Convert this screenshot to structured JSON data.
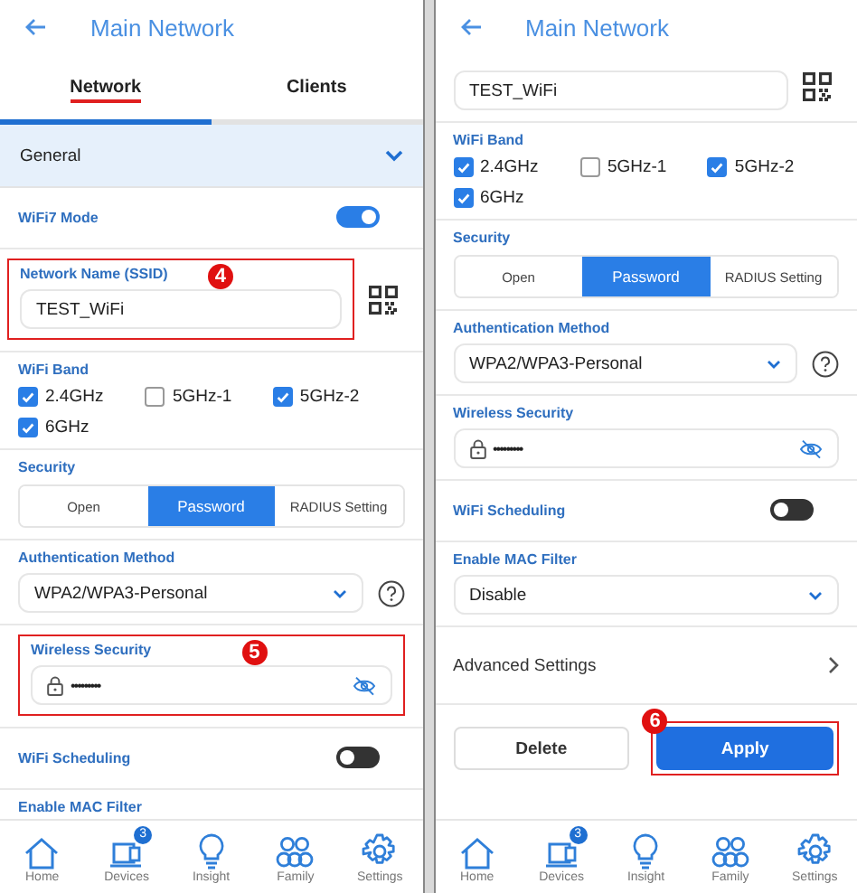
{
  "screens": [
    {
      "title": "Main Network",
      "tabs": [
        {
          "label": "Network",
          "selected": true,
          "annotated": true
        },
        {
          "label": "Clients",
          "selected": false,
          "annotated": false
        }
      ],
      "sections": [
        {
          "kind": "group",
          "label": "General",
          "expanded": true
        },
        {
          "kind": "toggle",
          "label": "WiFi7 Mode",
          "on": true
        },
        {
          "kind": "text_field",
          "label": "Network Name (SSID)",
          "value": "TEST_WiFi",
          "callout": "4"
        },
        {
          "kind": "checkboxes",
          "label": "WiFi Band",
          "options": [
            {
              "label": "2.4GHz",
              "checked": true
            },
            {
              "label": "5GHz-1",
              "checked": false
            },
            {
              "label": "5GHz-2",
              "checked": true
            },
            {
              "label": "6GHz",
              "checked": true
            }
          ]
        },
        {
          "kind": "segmented",
          "label": "Security",
          "options": [
            {
              "label": "Open",
              "selected": false
            },
            {
              "label": "Password",
              "selected": true
            },
            {
              "label": "RADIUS Setting",
              "selected": false
            }
          ]
        },
        {
          "kind": "select",
          "label": "Authentication Method",
          "value": "WPA2/WPA3-Personal",
          "help": true
        },
        {
          "kind": "password",
          "label": "Wireless Security",
          "value": "•••••••••",
          "callout": "5"
        },
        {
          "kind": "toggle",
          "label": "WiFi Scheduling",
          "on": false
        },
        {
          "kind": "heading",
          "label": "Enable MAC Filter"
        }
      ],
      "nav": [
        {
          "label": "Home"
        },
        {
          "label": "Devices",
          "badge": "3"
        },
        {
          "label": "Insight"
        },
        {
          "label": "Family"
        },
        {
          "label": "Settings"
        }
      ]
    },
    {
      "title": "Main Network",
      "sections": [
        {
          "kind": "text_field",
          "value": "TEST_WiFi"
        },
        {
          "kind": "checkboxes",
          "label": "WiFi Band",
          "options": [
            {
              "label": "2.4GHz",
              "checked": true
            },
            {
              "label": "5GHz-1",
              "checked": false
            },
            {
              "label": "5GHz-2",
              "checked": true
            },
            {
              "label": "6GHz",
              "checked": true
            }
          ]
        },
        {
          "kind": "segmented",
          "label": "Security",
          "options": [
            {
              "label": "Open",
              "selected": false
            },
            {
              "label": "Password",
              "selected": true
            },
            {
              "label": "RADIUS Setting",
              "selected": false
            }
          ]
        },
        {
          "kind": "select",
          "label": "Authentication Method",
          "value": "WPA2/WPA3-Personal",
          "help": true
        },
        {
          "kind": "password",
          "label": "Wireless Security",
          "value": "•••••••••"
        },
        {
          "kind": "toggle",
          "label": "WiFi Scheduling",
          "on": false
        },
        {
          "kind": "select",
          "label": "Enable MAC Filter",
          "value": "Disable"
        },
        {
          "kind": "link",
          "label": "Advanced Settings"
        },
        {
          "kind": "actions",
          "buttons": [
            {
              "label": "Delete",
              "primary": false
            },
            {
              "label": "Apply",
              "primary": true,
              "callout": "6"
            }
          ]
        }
      ],
      "nav": [
        {
          "label": "Home"
        },
        {
          "label": "Devices",
          "badge": "3"
        },
        {
          "label": "Insight"
        },
        {
          "label": "Family"
        },
        {
          "label": "Settings"
        }
      ]
    }
  ]
}
